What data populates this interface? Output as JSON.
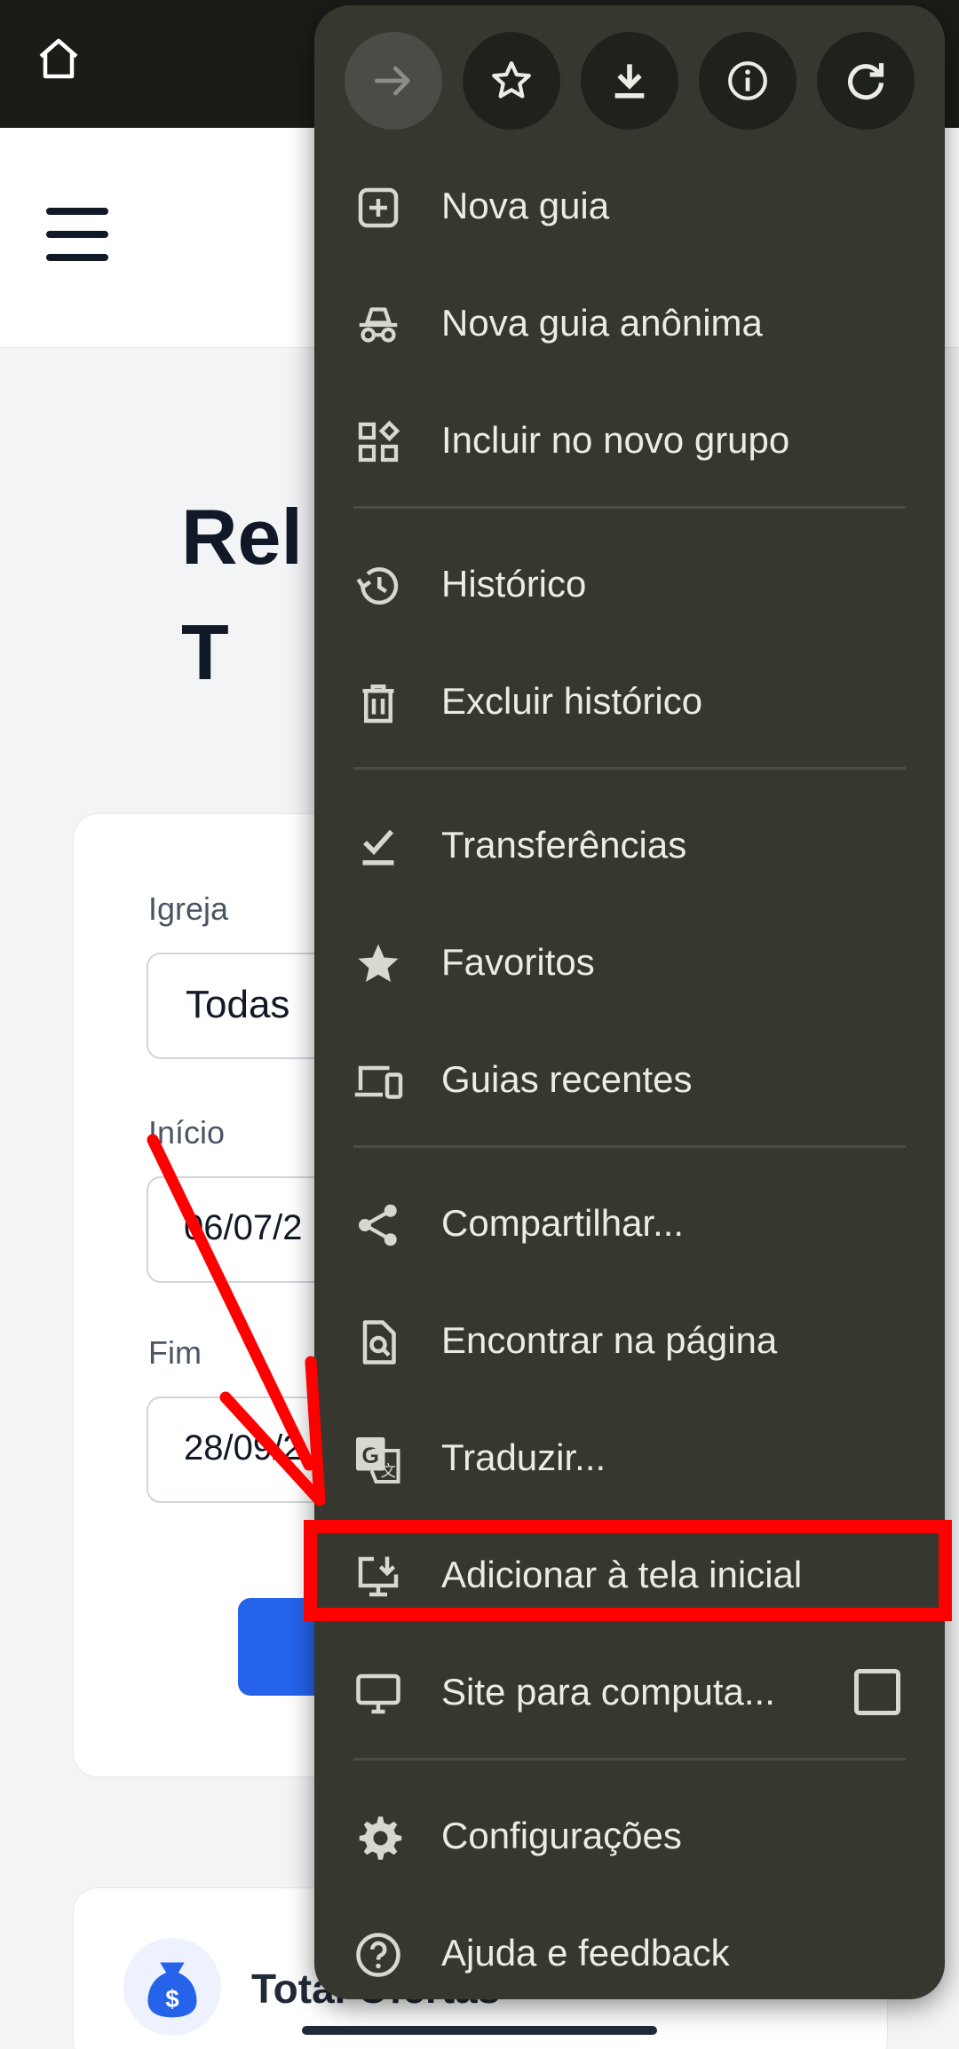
{
  "page": {
    "title": "Relatório de\nTransações",
    "title_visible_fragment": "Rel\nT",
    "filters": {
      "church_label": "Igreja",
      "church_value": "Todas",
      "start_label": "Início",
      "start_value": "06/07/2",
      "end_label": "Fim",
      "end_value": "28/09/2"
    },
    "summary_label": "Total Ofertas"
  },
  "menu": {
    "toolbar": [
      {
        "name": "forward-icon",
        "state": "disabled"
      },
      {
        "name": "bookmark-star-icon",
        "state": "enabled"
      },
      {
        "name": "download-icon",
        "state": "enabled"
      },
      {
        "name": "info-icon",
        "state": "enabled"
      },
      {
        "name": "refresh-icon",
        "state": "enabled"
      }
    ],
    "items": [
      {
        "label": "Nova guia",
        "icon": "new-tab-icon"
      },
      {
        "label": "Nova guia anônima",
        "icon": "incognito-icon"
      },
      {
        "label": "Incluir no novo grupo",
        "icon": "tab-group-icon"
      },
      {
        "label": "Histórico",
        "icon": "history-icon"
      },
      {
        "label": "Excluir histórico",
        "icon": "trash-icon"
      },
      {
        "label": "Transferências",
        "icon": "download-done-icon"
      },
      {
        "label": "Favoritos",
        "icon": "star-icon"
      },
      {
        "label": "Guias recentes",
        "icon": "devices-icon"
      },
      {
        "label": "Compartilhar...",
        "icon": "share-icon"
      },
      {
        "label": "Encontrar na página",
        "icon": "find-in-page-icon"
      },
      {
        "label": "Traduzir...",
        "icon": "translate-icon"
      },
      {
        "label": "Adicionar à tela inicial",
        "icon": "add-to-home-icon"
      },
      {
        "label": "Site para computa...",
        "icon": "desktop-icon",
        "checkbox": false
      },
      {
        "label": "Configurações",
        "icon": "settings-icon"
      },
      {
        "label": "Ajuda e feedback",
        "icon": "help-icon"
      }
    ]
  },
  "annotation": {
    "highlighted_item": "Adicionar à tela inicial",
    "color": "#ff0000"
  },
  "colors": {
    "menu_bg": "#363830",
    "menu_text": "#ecece4",
    "accent_blue": "#2563eb"
  }
}
